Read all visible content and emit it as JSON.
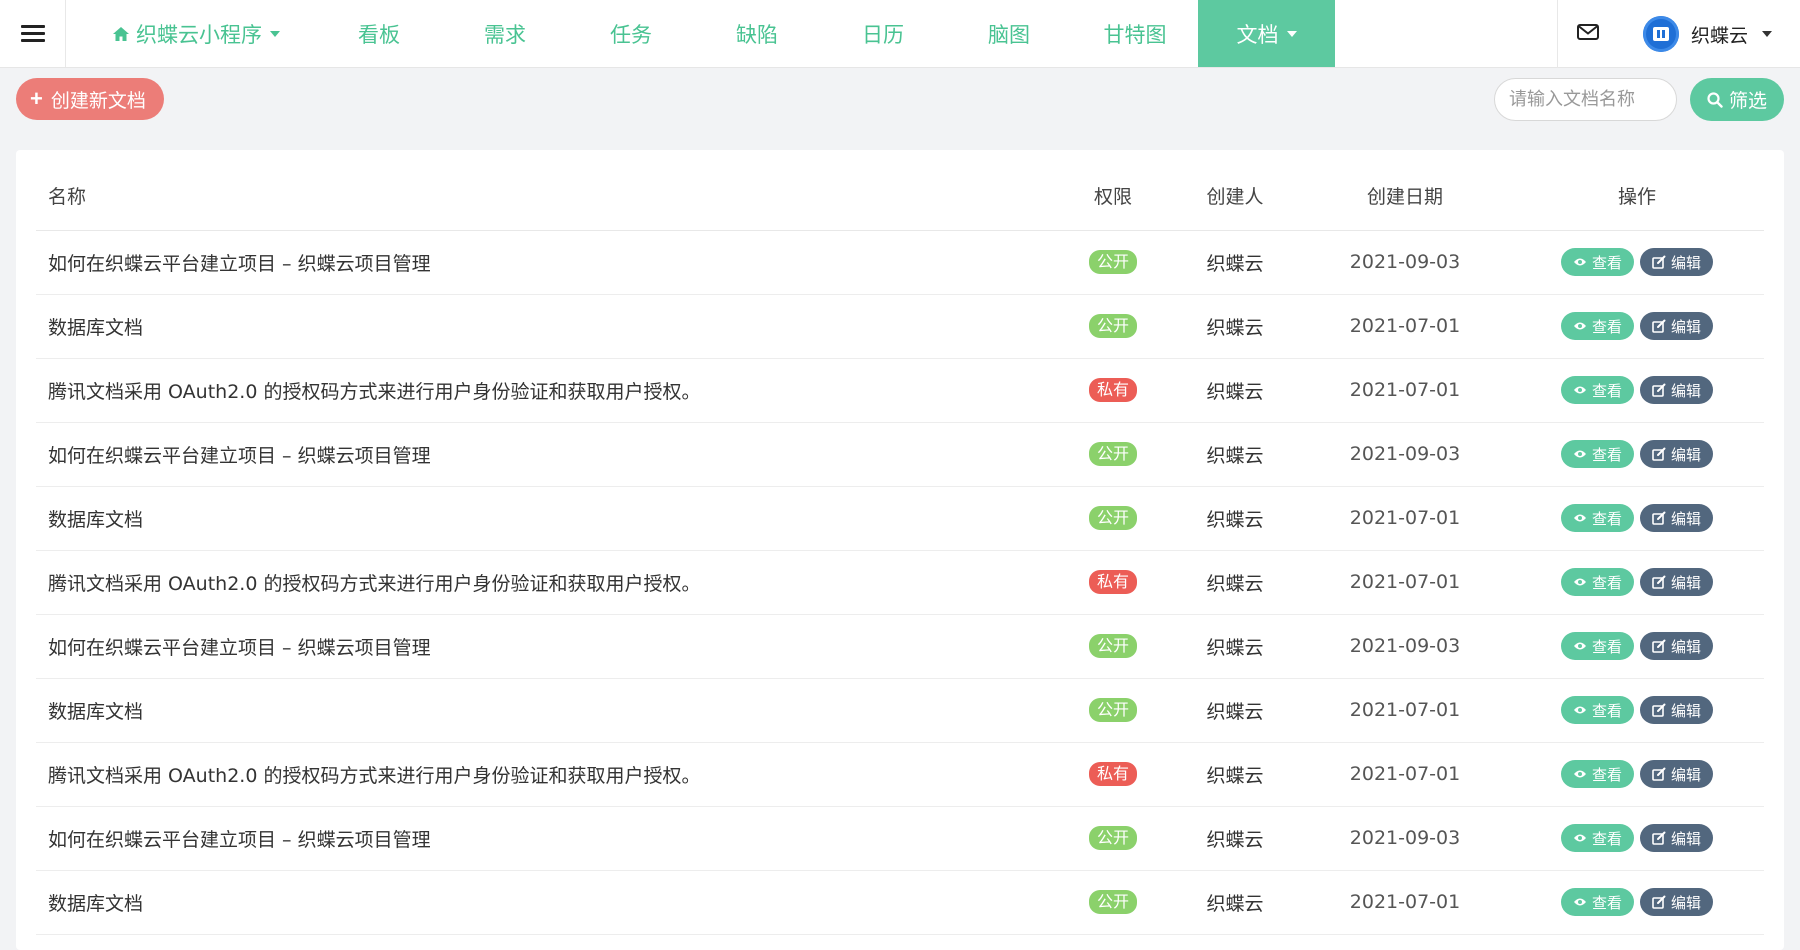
{
  "nav": {
    "project": "织蝶云小程序",
    "items": [
      "看板",
      "需求",
      "任务",
      "缺陷",
      "日历",
      "脑图",
      "甘特图"
    ],
    "active": "文档"
  },
  "user": {
    "name": "织蝶云"
  },
  "toolbar": {
    "create_label": "创建新文档",
    "search_placeholder": "请输入文档名称",
    "filter_label": "筛选"
  },
  "table": {
    "headers": {
      "name": "名称",
      "permission": "权限",
      "creator": "创建人",
      "date": "创建日期",
      "actions": "操作"
    },
    "view_label": "查看",
    "edit_label": "编辑",
    "rows": [
      {
        "name": "如何在织蝶云平台建立项目 – 织蝶云项目管理",
        "permission": "公开",
        "type": "public",
        "creator": "织蝶云",
        "date": "2021-09-03"
      },
      {
        "name": "数据库文档",
        "permission": "公开",
        "type": "public",
        "creator": "织蝶云",
        "date": "2021-07-01"
      },
      {
        "name": "腾讯文档采用 OAuth2.0 的授权码方式来进行用户身份验证和获取用户授权。",
        "permission": "私有",
        "type": "private",
        "creator": "织蝶云",
        "date": "2021-07-01"
      },
      {
        "name": "如何在织蝶云平台建立项目 – 织蝶云项目管理",
        "permission": "公开",
        "type": "public",
        "creator": "织蝶云",
        "date": "2021-09-03"
      },
      {
        "name": "数据库文档",
        "permission": "公开",
        "type": "public",
        "creator": "织蝶云",
        "date": "2021-07-01"
      },
      {
        "name": "腾讯文档采用 OAuth2.0 的授权码方式来进行用户身份验证和获取用户授权。",
        "permission": "私有",
        "type": "private",
        "creator": "织蝶云",
        "date": "2021-07-01"
      },
      {
        "name": "如何在织蝶云平台建立项目 – 织蝶云项目管理",
        "permission": "公开",
        "type": "public",
        "creator": "织蝶云",
        "date": "2021-09-03"
      },
      {
        "name": "数据库文档",
        "permission": "公开",
        "type": "public",
        "creator": "织蝶云",
        "date": "2021-07-01"
      },
      {
        "name": "腾讯文档采用 OAuth2.0 的授权码方式来进行用户身份验证和获取用户授权。",
        "permission": "私有",
        "type": "private",
        "creator": "织蝶云",
        "date": "2021-07-01"
      },
      {
        "name": "如何在织蝶云平台建立项目 – 织蝶云项目管理",
        "permission": "公开",
        "type": "public",
        "creator": "织蝶云",
        "date": "2021-09-03"
      },
      {
        "name": "数据库文档",
        "permission": "公开",
        "type": "public",
        "creator": "织蝶云",
        "date": "2021-07-01"
      }
    ]
  },
  "colors": {
    "brand": "#5dc9a0",
    "nav_text": "#49c392",
    "create": "#ec7d78",
    "public": "#8bd16b",
    "private": "#ec5d56",
    "edit": "#52677e"
  }
}
